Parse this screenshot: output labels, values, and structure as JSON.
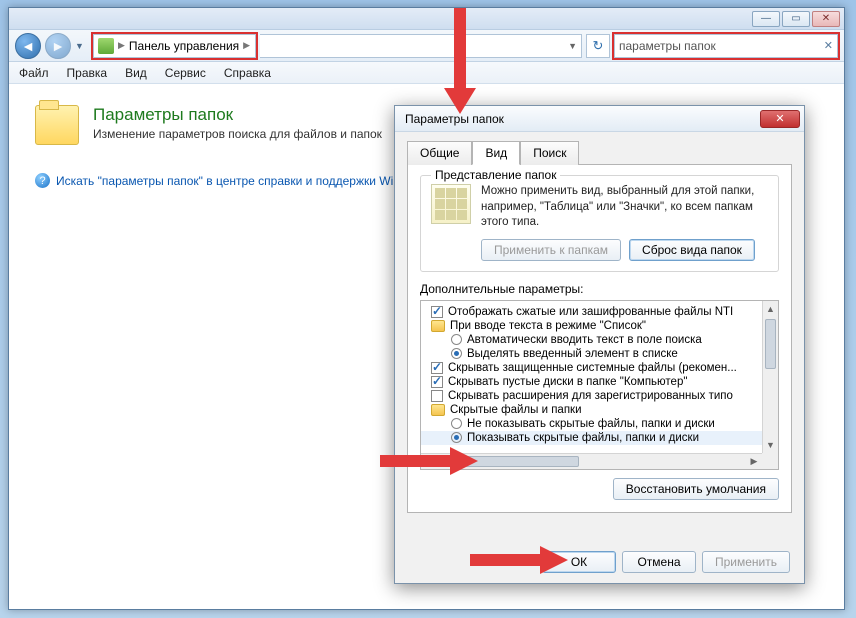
{
  "titlebar": {},
  "nav": {
    "breadcrumb_text": "Панель управления",
    "search_value": "параметры папок"
  },
  "menu": {
    "file": "Файл",
    "edit": "Правка",
    "view": "Вид",
    "service": "Сервис",
    "help": "Справка"
  },
  "page": {
    "title": "Параметры папок",
    "subtitle": "Изменение параметров поиска для файлов и папок",
    "help_link": "Искать \"параметры папок\" в центре справки и поддержки Win"
  },
  "dialog": {
    "title": "Параметры папок",
    "tabs": {
      "general": "Общие",
      "view": "Вид",
      "search": "Поиск"
    },
    "presentation": {
      "group": "Представление папок",
      "text": "Можно применить вид, выбранный для этой папки, например, \"Таблица\" или \"Значки\", ко всем папкам этого типа.",
      "apply_btn": "Применить к папкам",
      "reset_btn": "Сброс вида папок"
    },
    "advanced_label": "Дополнительные параметры:",
    "tree": {
      "r0": "Отображать сжатые или зашифрованные файлы NTI",
      "r1": "При вводе текста в режиме \"Список\"",
      "r1a": "Автоматически вводить текст в поле поиска",
      "r1b": "Выделять введенный элемент в списке",
      "r2": "Скрывать защищенные системные файлы (рекомен...",
      "r3": "Скрывать пустые диски в папке \"Компьютер\"",
      "r4": "Скрывать расширения для зарегистрированных типо",
      "r5": "Скрытые файлы и папки",
      "r5a": "Не показывать скрытые файлы, папки и диски",
      "r5b": "Показывать скрытые файлы, папки и диски"
    },
    "restore_defaults": "Восстановить умолчания",
    "ok": "ОК",
    "cancel": "Отмена",
    "apply": "Применить"
  }
}
